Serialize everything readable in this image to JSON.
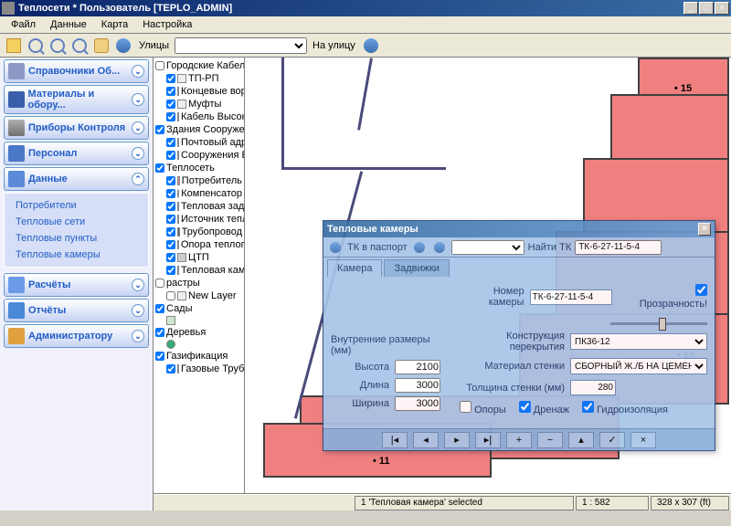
{
  "title": "Теплосети * Пользователь [TEPLO_ADMIN]",
  "menu": {
    "file": "Файл",
    "data": "Данные",
    "map": "Карта",
    "settings": "Настройка"
  },
  "toolbar": {
    "streets_label": "Улицы",
    "to_street": "На улицу"
  },
  "sidebar": {
    "ref": "Справочники Об...",
    "mat": "Материалы и обору...",
    "dev": "Приборы Контроля",
    "per": "Персонал",
    "data": "Данные",
    "data_items": [
      "Потребители",
      "Тепловые сети",
      "Тепловые пункты",
      "Тепловые камеры"
    ],
    "calc": "Расчёты",
    "rep": "Отчёты",
    "adm": "Администратору"
  },
  "layers": {
    "group1": "Городские Кабель",
    "g1": [
      "ТП-РП",
      "Концевые вор",
      "Муфты",
      "Кабель Высок"
    ],
    "group2": "Здания Сооружени",
    "g2": [
      "Почтовый адр",
      "Сооружения Б"
    ],
    "group3": "Теплосеть",
    "g3": [
      "Потребитель",
      "Компенсатор",
      "Тепловая зад",
      "Источник тепл",
      "Трубопровод",
      "Опора теплопр",
      "ЦТП",
      "Тепловая кам"
    ],
    "group4": "растры",
    "g4": [
      "New Layer"
    ],
    "group5": "Сады",
    "group6": "Деревья",
    "group7": "Газификация",
    "g7": [
      "Газовые Труб"
    ]
  },
  "map_labels": {
    "l11": "• 11",
    "l13": "• 13",
    "l15": "• 15"
  },
  "dialog": {
    "title": "Тепловые камеры",
    "passport": "ТК в паспорт",
    "find_label": "Найти ТК",
    "find_value": "ТК-6-27-11-5-4",
    "tab1": "Камера",
    "tab2": "Задвижки",
    "num_label": "Номер камеры",
    "num_value": "ТК-6-27-11-5-4",
    "transp": "Прозрачность!",
    "dims_label": "Внутренние размеры (мм)",
    "h_label": "Высота",
    "h_value": "2100",
    "l_label": "Длина",
    "l_value": "3000",
    "w_label": "Ширина",
    "w_value": "3000",
    "konstr_label": "Конструкция перекрытия",
    "konstr_value": "ПК36-12",
    "mat_label": "Материал стенки",
    "mat_value": "СБОРНЫЙ Ж./Б НА ЦЕМЕНТНОМ РА",
    "thick_label": "Толщина стенки (мм)",
    "thick_value": "280",
    "cb1": "Опоры",
    "cb2": "Дренаж",
    "cb3": "Гидроизоляция"
  },
  "status": {
    "sel": "1 'Тепловая камера' selected",
    "scale": "1 : 582",
    "coords": "328 x 307 (ft)"
  }
}
